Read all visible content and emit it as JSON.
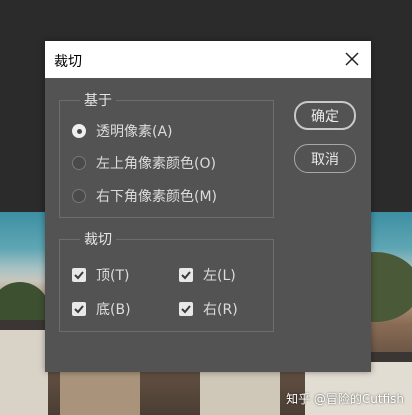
{
  "dialog": {
    "title": "裁切",
    "close_icon": "close-icon"
  },
  "based_on": {
    "label": "基于",
    "options": [
      {
        "label": "透明像素(A)",
        "selected": true
      },
      {
        "label": "左上角像素颜色(O)",
        "selected": false
      },
      {
        "label": "右下角像素颜色(M)",
        "selected": false
      }
    ]
  },
  "trim_away": {
    "label": "裁切",
    "top": {
      "label": "顶(T)",
      "checked": true
    },
    "left": {
      "label": "左(L)",
      "checked": true
    },
    "bottom": {
      "label": "底(B)",
      "checked": true
    },
    "right": {
      "label": "右(R)",
      "checked": true
    }
  },
  "buttons": {
    "ok": "确定",
    "cancel": "取消"
  },
  "watermark": "知乎 @冒险的Cutfish",
  "colors": {
    "dialog_bg": "#535353",
    "titlebar_bg": "#ffffff",
    "text": "#dcdcdc"
  }
}
